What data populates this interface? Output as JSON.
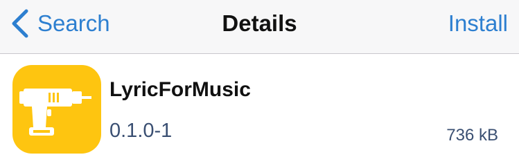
{
  "navbar": {
    "back_label": "Search",
    "title": "Details",
    "install_label": "Install"
  },
  "package": {
    "name": "LyricForMusic",
    "version": "0.1.0-1",
    "size": "736 kB",
    "icon": "power-drill-icon",
    "icon_bg": "#fec510"
  },
  "colors": {
    "accent": "#2d7fd0",
    "nav_bg": "#f7f7f8",
    "detail_text": "#3a4f72"
  }
}
